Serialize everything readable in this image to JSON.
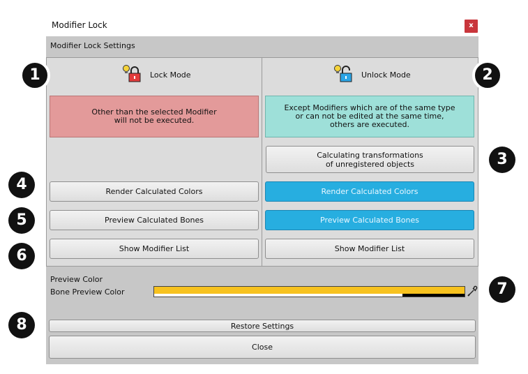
{
  "window": {
    "title": "Modifier Lock",
    "close_glyph": "x"
  },
  "header": {
    "settings_label": "Modifier Lock Settings"
  },
  "lock_mode": {
    "label": "Lock Mode",
    "icon": "red-padlock-lightbulb-icon",
    "description": "Other than the selected Modifier\nwill not be executed.",
    "buttons": {
      "render": "Render Calculated Colors",
      "preview": "Preview Calculated Bones",
      "show_list": "Show Modifier List"
    }
  },
  "unlock_mode": {
    "label": "Unlock Mode",
    "icon": "blue-open-padlock-lightbulb-icon",
    "description": "Except Modifiers which are of the same type\nor can not be edited at the same time,\nothers are executed.",
    "buttons": {
      "calc_transform": "Calculating transformations\nof unregistered objects",
      "render": "Render Calculated Colors",
      "preview": "Preview Calculated Bones",
      "show_list": "Show Modifier List"
    }
  },
  "preview_color": {
    "section_label": "Preview Color",
    "bone_label": "Bone Preview Color",
    "bone_color": "#f7c21f",
    "picker_icon": "eyedropper-icon"
  },
  "footer": {
    "restore": "Restore Settings",
    "close": "Close"
  },
  "markers": [
    "1",
    "2",
    "3",
    "4",
    "5",
    "6",
    "7",
    "8"
  ],
  "colors": {
    "lock_info_bg": "#e39a9a",
    "unlock_info_bg": "#9ee0d9",
    "active_button": "#27aee0",
    "title_close": "#c9363c"
  }
}
